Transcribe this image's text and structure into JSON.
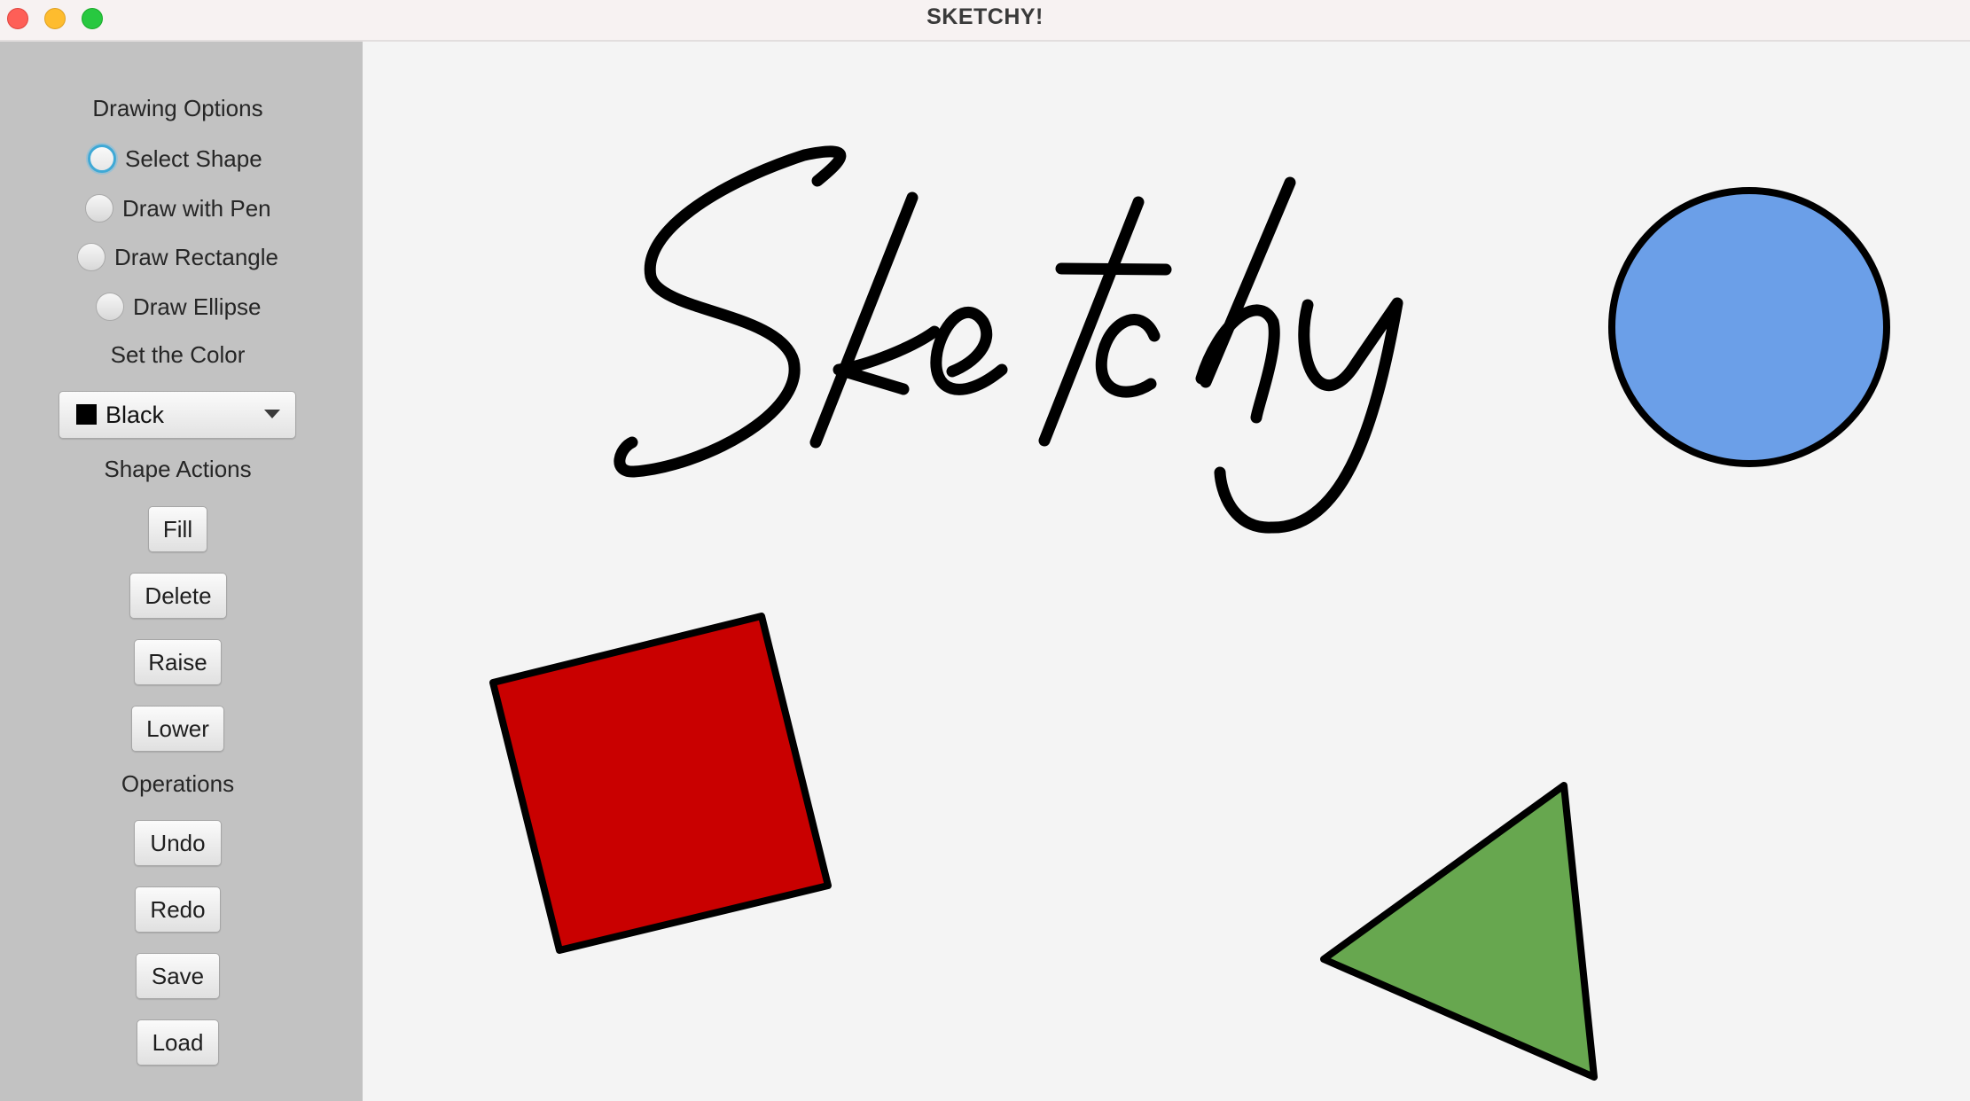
{
  "window": {
    "title": "SKETCHY!"
  },
  "sidebar": {
    "drawing_options_label": "Drawing Options",
    "drawing_modes": [
      {
        "label": "Select Shape",
        "selected": false,
        "focused": true
      },
      {
        "label": "Draw with Pen",
        "selected": false,
        "focused": false
      },
      {
        "label": "Draw Rectangle",
        "selected": false,
        "focused": false
      },
      {
        "label": "Draw Ellipse",
        "selected": false,
        "focused": false
      }
    ],
    "color_label": "Set the Color",
    "color_select": {
      "value": "Black",
      "swatch_color": "#000000"
    },
    "shape_actions_label": "Shape Actions",
    "shape_actions": [
      "Fill",
      "Delete",
      "Raise",
      "Lower"
    ],
    "operations_label": "Operations",
    "operations": [
      "Undo",
      "Redo",
      "Save",
      "Load"
    ]
  },
  "canvas": {
    "background": "#f4f4f4",
    "pen_text": "Sketchy",
    "pen_color": "#000000",
    "shapes": [
      {
        "type": "ellipse",
        "fill": "#6b9fe8",
        "stroke": "#000000"
      },
      {
        "type": "rectangle",
        "fill": "#c90000",
        "stroke": "#000000"
      },
      {
        "type": "triangle",
        "fill": "#67a74f",
        "stroke": "#000000"
      }
    ]
  },
  "colors": {
    "sidebar_bg": "#c2c2c2",
    "focus_ring": "#3fa9d6"
  }
}
